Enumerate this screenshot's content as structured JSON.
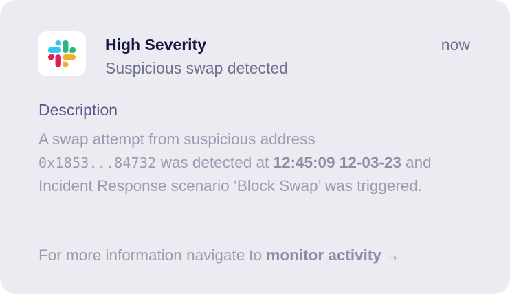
{
  "notification": {
    "app_icon": "slack-icon",
    "title": "High Severity",
    "subtitle": "Suspicious swap detected",
    "timestamp": "now",
    "section_label": "Description",
    "description": {
      "prefix": "A swap attempt from suspicious address",
      "address": "0x1853...84732",
      "middle": " was detected at ",
      "datetime": "12:45:09 12-03-23",
      "suffix": " and Incident Response scenario ‘Block Swap’ was triggered."
    },
    "footer": {
      "text": "For more information navigate to ",
      "link_label": "monitor activity",
      "arrow": "→",
      "arrow_icon": "arrow-right-icon"
    }
  },
  "colors": {
    "card_background": "#ebebf1",
    "title": "#13173f",
    "muted": "#6f7390",
    "section_label": "#55598a",
    "body_text": "#9a9cb0",
    "slack_blue": "#36C5F0",
    "slack_green": "#2EB67D",
    "slack_red": "#E01E5A",
    "slack_yellow": "#ECB22E"
  }
}
